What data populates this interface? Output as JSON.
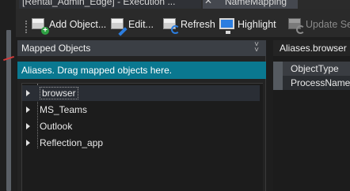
{
  "tabs": [
    {
      "label": "[Rental_Admin_Edge] - Execution ..."
    },
    {
      "label": "NameMapping"
    }
  ],
  "toolbar": {
    "add_object": "Add Object...",
    "edit": "Edit...",
    "refresh": "Refresh",
    "highlight": "Highlight",
    "update": "Update Se"
  },
  "mapped_objects": {
    "title": "Mapped Objects",
    "hint": "Aliases. Drag mapped objects here.",
    "items": [
      {
        "label": "browser"
      },
      {
        "label": "MS_Teams"
      },
      {
        "label": "Outlook"
      },
      {
        "label": "Reflection_app"
      }
    ]
  },
  "properties": {
    "title": "Aliases.browser",
    "rows": [
      {
        "label": "ObjectType"
      },
      {
        "label": "ProcessName"
      }
    ]
  },
  "colors": {
    "hint_bg": "#0a7890",
    "header_bg": "#3b3f45",
    "background": "#1e1e1e"
  }
}
